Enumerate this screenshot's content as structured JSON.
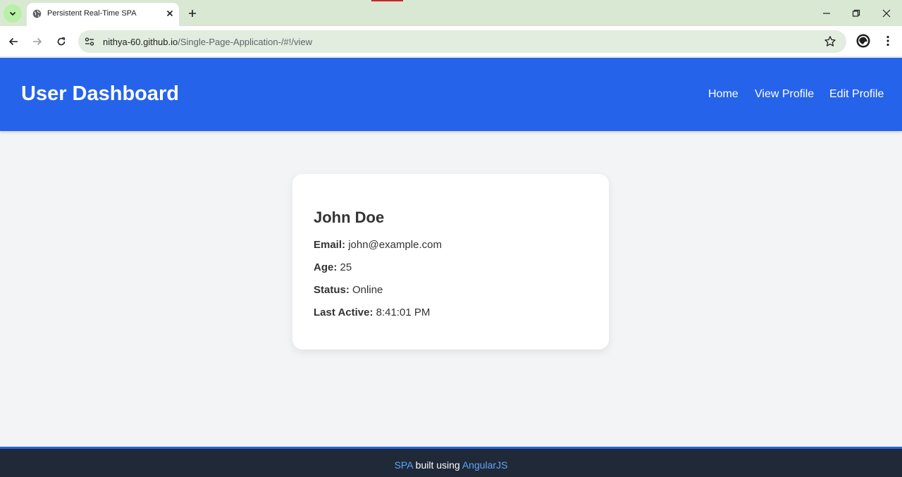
{
  "browser": {
    "tab_title": "Persistent Real-Time SPA",
    "url_host": "nithya-60.github.io",
    "url_path": "/Single-Page-Application-/#!/view",
    "icons": [
      "tab-search-icon",
      "globe-icon",
      "close-icon",
      "plus-icon",
      "minimize-icon",
      "restore-icon",
      "close-window-icon",
      "back-icon",
      "forward-icon",
      "reload-icon",
      "site-info-icon",
      "star-icon",
      "profile-icon",
      "more-menu-icon"
    ]
  },
  "header": {
    "title": "User Dashboard",
    "nav": [
      {
        "label": "Home"
      },
      {
        "label": "View Profile"
      },
      {
        "label": "Edit Profile"
      }
    ]
  },
  "profile": {
    "name": "John Doe",
    "fields": [
      {
        "label": "Email:",
        "value": "john@example.com"
      },
      {
        "label": "Age:",
        "value": "25"
      },
      {
        "label": "Status:",
        "value": "Online"
      },
      {
        "label": "Last Active:",
        "value": "8:41:01 PM"
      }
    ]
  },
  "footer": {
    "link1": "SPA",
    "middle": "built using",
    "link2": "AngularJS"
  },
  "colors": {
    "header_bg": "#2563eb",
    "page_bg": "#f3f4f6",
    "footer_bg": "#1f2937",
    "footer_link": "#60a5fa",
    "tabstrip_bg": "#d9e8d3"
  }
}
